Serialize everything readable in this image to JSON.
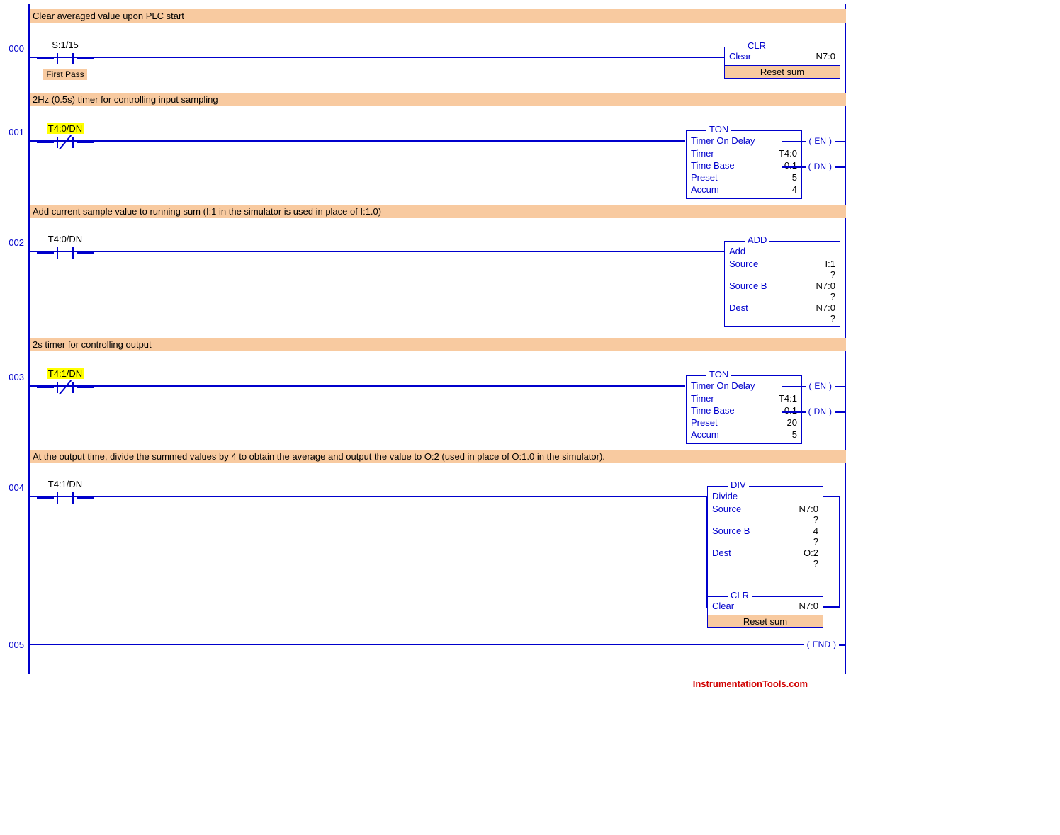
{
  "rungs": {
    "r0": {
      "num": "000",
      "comment": "Clear averaged value upon PLC start",
      "contact": {
        "addr": "S:1/15",
        "desc": "First Pass",
        "type": "XIO"
      },
      "instr": {
        "header": "CLR",
        "title": "Clear",
        "val": "N7:0",
        "footer": "Reset sum"
      }
    },
    "r1": {
      "num": "001",
      "comment": "2Hz (0.5s) timer for controlling input sampling",
      "contact": {
        "addr": "T4:0/DN",
        "type": "XIC",
        "highlight": true
      },
      "instr": {
        "header": "TON",
        "title": "Timer On Delay",
        "rows": [
          {
            "label": "Timer",
            "val": "T4:0"
          },
          {
            "label": "Time Base",
            "val": "0.1"
          },
          {
            "label": "Preset",
            "val": "5"
          },
          {
            "label": "Accum",
            "val": "4"
          }
        ]
      },
      "outputs": {
        "en": "EN",
        "dn": "DN"
      }
    },
    "r2": {
      "num": "002",
      "comment": "Add current sample value to running sum (I:1 in the simulator is used in place of I:1.0)",
      "contact": {
        "addr": "T4:0/DN",
        "type": "XIO"
      },
      "instr": {
        "header": "ADD",
        "title": "Add",
        "rows": [
          {
            "label": "Source",
            "val": "I:1",
            "q": "?"
          },
          {
            "label": "Source B",
            "val": "N7:0",
            "q": "?"
          },
          {
            "label": "Dest",
            "val": "N7:0",
            "q": "?"
          }
        ]
      }
    },
    "r3": {
      "num": "003",
      "comment": "2s timer for controlling output",
      "contact": {
        "addr": "T4:1/DN",
        "type": "XIC",
        "highlight": true
      },
      "instr": {
        "header": "TON",
        "title": "Timer On Delay",
        "rows": [
          {
            "label": "Timer",
            "val": "T4:1"
          },
          {
            "label": "Time Base",
            "val": "0.1"
          },
          {
            "label": "Preset",
            "val": "20"
          },
          {
            "label": "Accum",
            "val": "5"
          }
        ]
      },
      "outputs": {
        "en": "EN",
        "dn": "DN"
      }
    },
    "r4": {
      "num": "004",
      "comment": "At the output time, divide the summed values by 4 to obtain the average and output the value to O:2 (used in place of O:1.0 in the simulator).",
      "contact": {
        "addr": "T4:1/DN",
        "type": "XIO"
      },
      "instr1": {
        "header": "DIV",
        "title": "Divide",
        "rows": [
          {
            "label": "Source",
            "val": "N7:0",
            "q": "?"
          },
          {
            "label": "Source B",
            "val": "4",
            "q": "?"
          },
          {
            "label": "Dest",
            "val": "O:2",
            "q": "?"
          }
        ]
      },
      "instr2": {
        "header": "CLR",
        "title": "Clear",
        "val": "N7:0",
        "footer": "Reset sum"
      }
    },
    "r5": {
      "num": "005",
      "end": "END"
    }
  },
  "footer": "InstrumentationTools.com"
}
